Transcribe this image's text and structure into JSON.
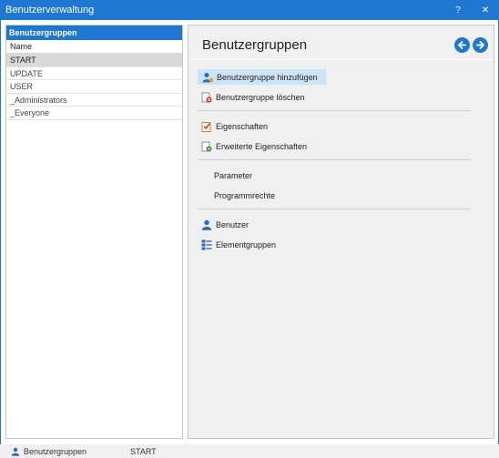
{
  "window": {
    "title": "Benutzerverwaltung",
    "help_label": "?",
    "close_label": "✕"
  },
  "left": {
    "header": "Benutzergruppen",
    "column": "Name",
    "rows": [
      "START",
      "UPDATE",
      "USER",
      "_Administrators",
      "_Everyone"
    ],
    "selected_index": 0
  },
  "right": {
    "title": "Benutzergruppen",
    "actions": {
      "add": "Benutzergruppe hinzufügen",
      "delete": "Benutzergruppe löschen",
      "properties": "Eigenschaften",
      "ext_properties": "Erweiterte Eigenschaften",
      "parameter": "Parameter",
      "program_rights": "Programmrechte",
      "users": "Benutzer",
      "element_groups": "Elementgruppen"
    }
  },
  "status": {
    "label": "Benutzergruppen",
    "value": "START"
  },
  "colors": {
    "accent": "#1e78d2",
    "selection": "#d9d9d9",
    "hover": "#cce4f7"
  }
}
